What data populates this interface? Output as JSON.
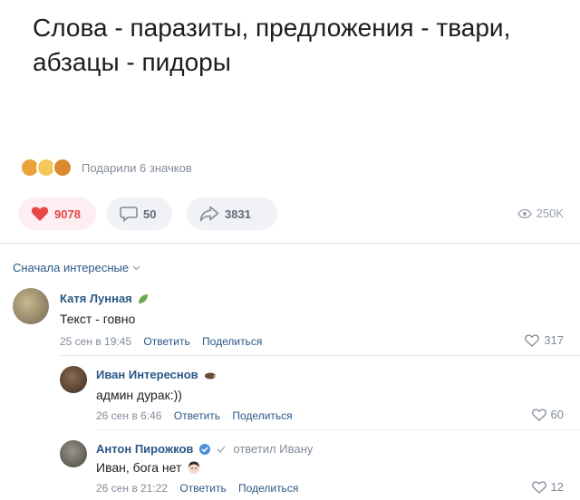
{
  "post": {
    "text": "Слова - паразиты, предложения - твари, абзацы - пидоры",
    "gifts_label": "Подарили 6 значков"
  },
  "actions": {
    "likes": "9078",
    "comments": "50",
    "shares": "3831",
    "views": "250K"
  },
  "comments_sort": "Сначала интересные",
  "comments": [
    {
      "author": "Катя Лунная",
      "text": "Текст - говно",
      "date": "25 сен в 19:45",
      "reply_label": "Ответить",
      "share_label": "Поделиться",
      "likes": "317"
    },
    {
      "author": "Иван Интереснов",
      "text": "админ дурак:))",
      "date": "26 сен в 6:46",
      "reply_label": "Ответить",
      "share_label": "Поделиться",
      "likes": "60"
    },
    {
      "author": "Антон Пирожков",
      "replied_to": "ответил Ивану",
      "text": "Иван, бога нет",
      "date": "26 сен в 21:22",
      "reply_label": "Ответить",
      "share_label": "Поделиться",
      "likes": "12"
    }
  ],
  "colors": {
    "link": "#2a5885",
    "like_red": "#e64646",
    "muted": "#818c99"
  }
}
